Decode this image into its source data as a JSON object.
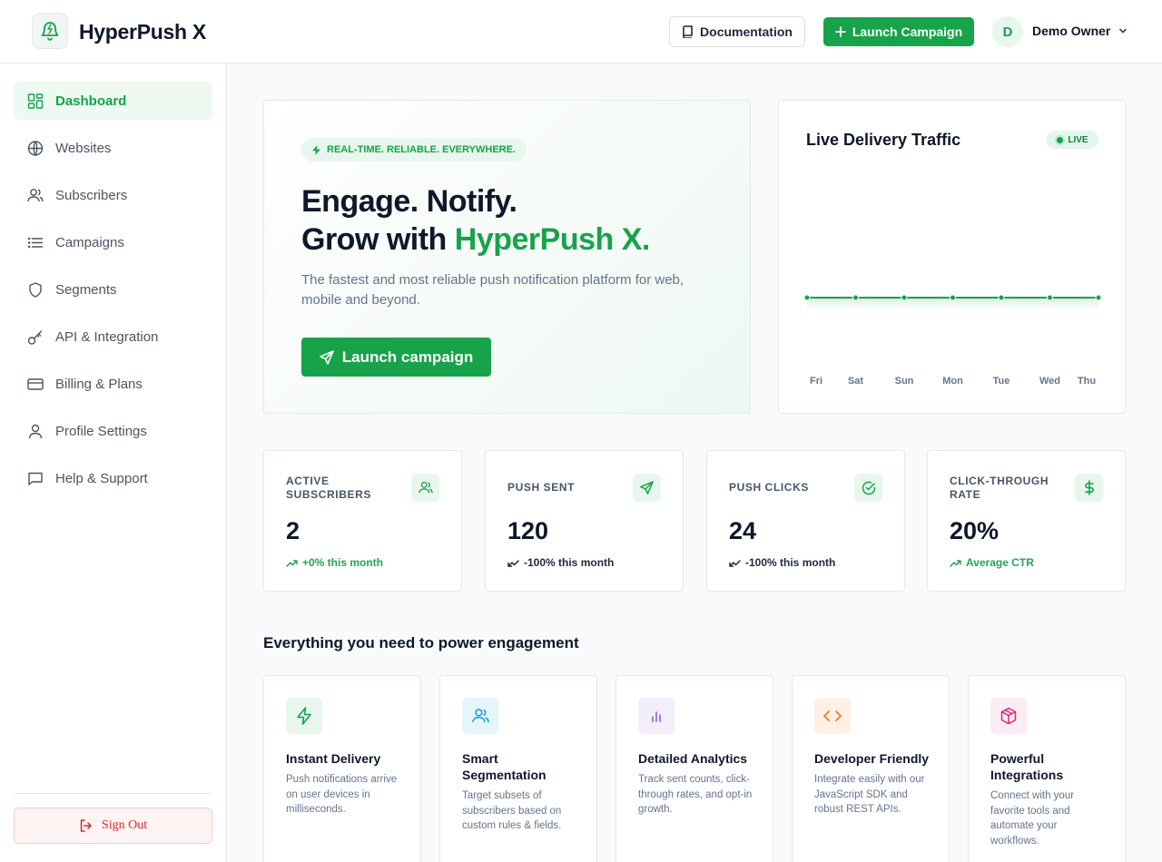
{
  "app": {
    "title": "HyperPush X"
  },
  "header": {
    "documentation_label": "Documentation",
    "launch_label": "Launch Campaign",
    "user_initial": "D",
    "user_name": "Demo Owner"
  },
  "sidebar": {
    "items": [
      {
        "label": "Dashboard",
        "icon": "dashboard-icon",
        "active": true
      },
      {
        "label": "Websites",
        "icon": "globe-icon"
      },
      {
        "label": "Subscribers",
        "icon": "users-icon"
      },
      {
        "label": "Campaigns",
        "icon": "list-icon"
      },
      {
        "label": "Segments",
        "icon": "shield-icon"
      },
      {
        "label": "API & Integration",
        "icon": "key-icon"
      },
      {
        "label": "Billing & Plans",
        "icon": "credit-card-icon"
      },
      {
        "label": "Profile Settings",
        "icon": "user-icon"
      },
      {
        "label": "Help & Support",
        "icon": "chat-icon"
      }
    ],
    "signout_label": "Sign Out"
  },
  "hero": {
    "badge": "REAL-TIME. RELIABLE. EVERYWHERE.",
    "headline_line1": "Engage. Notify.",
    "headline_line2_prefix": "Grow with ",
    "headline_line2_accent": "HyperPush X.",
    "description": "The fastest and most reliable push notification platform for web, mobile and beyond.",
    "cta_label": "Launch campaign"
  },
  "traffic": {
    "title": "Live Delivery Traffic",
    "live_label": "LIVE"
  },
  "chart_data": {
    "type": "line",
    "title": "Live Delivery Traffic",
    "categories": [
      "Fri",
      "Sat",
      "Sun",
      "Mon",
      "Tue",
      "Wed",
      "Thu"
    ],
    "series": [
      {
        "values": [
          0,
          0,
          0,
          0,
          0,
          0,
          0
        ]
      }
    ],
    "ylim": [
      0,
      1
    ],
    "grid": false,
    "color": "#16a34a"
  },
  "stats": [
    {
      "label": "ACTIVE SUBSCRIBERS",
      "value": "2",
      "trend": "+0% this month",
      "direction": "up",
      "icon": "users-icon"
    },
    {
      "label": "PUSH SENT",
      "value": "120",
      "trend": "-100% this month",
      "direction": "down",
      "icon": "send-icon"
    },
    {
      "label": "PUSH CLICKS",
      "value": "24",
      "trend": "-100% this month",
      "direction": "down",
      "icon": "check-circle-icon"
    },
    {
      "label": "CLICK-THROUGH RATE",
      "value": "20%",
      "trend": "Average CTR",
      "direction": "up",
      "icon": "dollar-icon"
    }
  ],
  "features": {
    "section_title": "Everything you need to power engagement",
    "items": [
      {
        "title": "Instant Delivery",
        "description": "Push notifications arrive on user devices in milliseconds.",
        "icon": "lightning-icon",
        "color": "#16a34a",
        "bg": "#e8f7ee"
      },
      {
        "title": "Smart Segmentation",
        "description": "Target subsets of subscribers based on custom rules & fields.",
        "icon": "users-icon",
        "color": "#0ea5e9",
        "bg": "#e6f4fc"
      },
      {
        "title": "Detailed Analytics",
        "description": "Track sent counts, click-through rates, and opt-in growth.",
        "icon": "bar-chart-icon",
        "color": "#8b5cf6",
        "bg": "#f2eefd"
      },
      {
        "title": "Developer Friendly",
        "description": "Integrate easily with our JavaScript SDK and robust REST APIs.",
        "icon": "code-icon",
        "color": "#f97316",
        "bg": "#fef0e6"
      },
      {
        "title": "Powerful Integrations",
        "description": "Connect with your favorite tools and automate your workflows.",
        "icon": "cube-icon",
        "color": "#db2777",
        "bg": "#fdecf3"
      }
    ]
  }
}
